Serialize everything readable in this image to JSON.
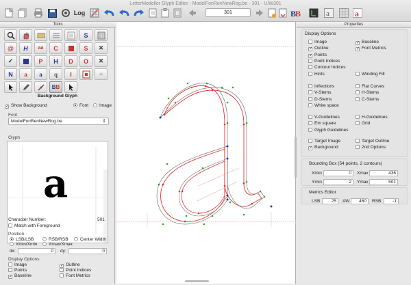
{
  "window": {
    "title": "LetterModeller Glyph Editor - ModelFonRenNewRog.be - 301 - U/W301"
  },
  "toolbar": {
    "log_label": "Log",
    "glyph_number": "301"
  },
  "tools_panel": {
    "title": "Tools",
    "background_glyph_label": "Background Glyph",
    "show_background_label": "Show Background",
    "font_option": "Font",
    "image_option": "Image",
    "font_section_label": "Font",
    "font_selected": "ModelFonRenNewRog.be",
    "glyph_section_label": "Glyph",
    "character_number_label": "Character Number:",
    "character_number_value": "501",
    "match_foreground_label": "Match with Foreground",
    "position_label": "Position",
    "lsb_lsb": "LSB/LSB",
    "rsb_rsb": "RSB/RSB",
    "center_width": "Center Width",
    "xmin_xmin": "Xmin/Xmin",
    "xmax_xmax": "Xmax/Xmax",
    "dx_label": "dx:",
    "dx_value": "0",
    "dy_label": "dy:",
    "dy_value": "0",
    "display_options_label": "Display Options",
    "opt_image": "Image",
    "opt_outline": "Outline",
    "opt_points": "Points",
    "opt_point_indices": "Point Indices",
    "opt_baseline": "Baseline",
    "opt_font_metrics": "Font Metrics",
    "preview_glyph": "a"
  },
  "properties_panel": {
    "title": "Properties",
    "display_options_label": "Display Options",
    "options_col1": [
      {
        "label": "Image",
        "checked": false
      },
      {
        "label": "Outline",
        "checked": true
      },
      {
        "label": "Points",
        "checked": true
      },
      {
        "label": "Point Indices",
        "checked": false
      },
      {
        "label": "Contour Indices",
        "checked": false
      },
      {
        "label": "Hints",
        "checked": false
      }
    ],
    "options_col2": [
      {
        "label": "Baseline",
        "checked": true
      },
      {
        "label": "Font Metrics",
        "checked": true
      },
      {
        "label": "Winding Fill",
        "checked": false
      }
    ],
    "stems_col1": [
      {
        "label": "Inflections",
        "checked": false
      },
      {
        "label": "V-Stems",
        "checked": false
      },
      {
        "label": "D-Stems",
        "checked": false
      },
      {
        "label": "White space",
        "checked": false
      }
    ],
    "stems_col2": [
      {
        "label": "Flat Curves",
        "checked": false
      },
      {
        "label": "H-Stems",
        "checked": false
      },
      {
        "label": "C-Stems",
        "checked": false
      }
    ],
    "guides_col1": [
      {
        "label": "V-Guidelines",
        "checked": false
      },
      {
        "label": "Em square",
        "checked": false
      },
      {
        "label": "Glyph Guidelines",
        "checked": false
      }
    ],
    "guides_col2": [
      {
        "label": "H-Guidelines",
        "checked": false
      },
      {
        "label": "Grid",
        "checked": false
      }
    ],
    "target_col1": [
      {
        "label": "Target Image",
        "checked": false
      },
      {
        "label": "Background",
        "checked": true
      }
    ],
    "target_col2": [
      {
        "label": "Target Outline",
        "checked": false
      },
      {
        "label": "2nd Options",
        "checked": false
      }
    ],
    "bbox_label": "Bounding Box (54 points, 2 contours)",
    "xmin_label": "Xmin",
    "xmin_value": "0",
    "xmax_label": "Xmax",
    "xmax_value": "436",
    "ymin_label": "Ymin",
    "ymin_value": "2",
    "ymax_label": "Ymax",
    "ymax_value": "501",
    "metrics_label": "Metrics Editor",
    "lsb_label": "LSB",
    "lsb_value": "25",
    "aw_label": "AW",
    "aw_value": "460",
    "rsb_label": "RSB",
    "rsb_value": "-1"
  },
  "colors": {
    "outline_red": "#d33",
    "outline_gray": "#777",
    "point_green": "#2a2",
    "point_blue": "#23c"
  }
}
